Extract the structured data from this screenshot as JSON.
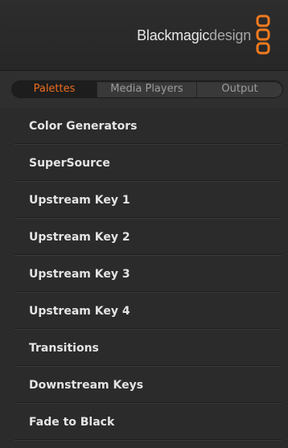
{
  "brand": {
    "name_primary": "Blackmagic",
    "name_secondary": "design",
    "logo_icon": "blackmagic-logo-icon",
    "logo_color": "#f07a1e"
  },
  "tabs": [
    {
      "label": "Palettes",
      "active": true
    },
    {
      "label": "Media Players",
      "active": false
    },
    {
      "label": "Output",
      "active": false
    }
  ],
  "colors": {
    "accent": "#ee6d1f",
    "background": "#2b2b2b",
    "text": "#e4e4e4",
    "tab_inactive_text": "#9c9c9c"
  },
  "palettes": [
    {
      "label": "Color Generators"
    },
    {
      "label": "SuperSource"
    },
    {
      "label": "Upstream Key 1"
    },
    {
      "label": "Upstream Key 2"
    },
    {
      "label": "Upstream Key 3"
    },
    {
      "label": "Upstream Key 4"
    },
    {
      "label": "Transitions"
    },
    {
      "label": "Downstream Keys"
    },
    {
      "label": "Fade to Black"
    }
  ]
}
